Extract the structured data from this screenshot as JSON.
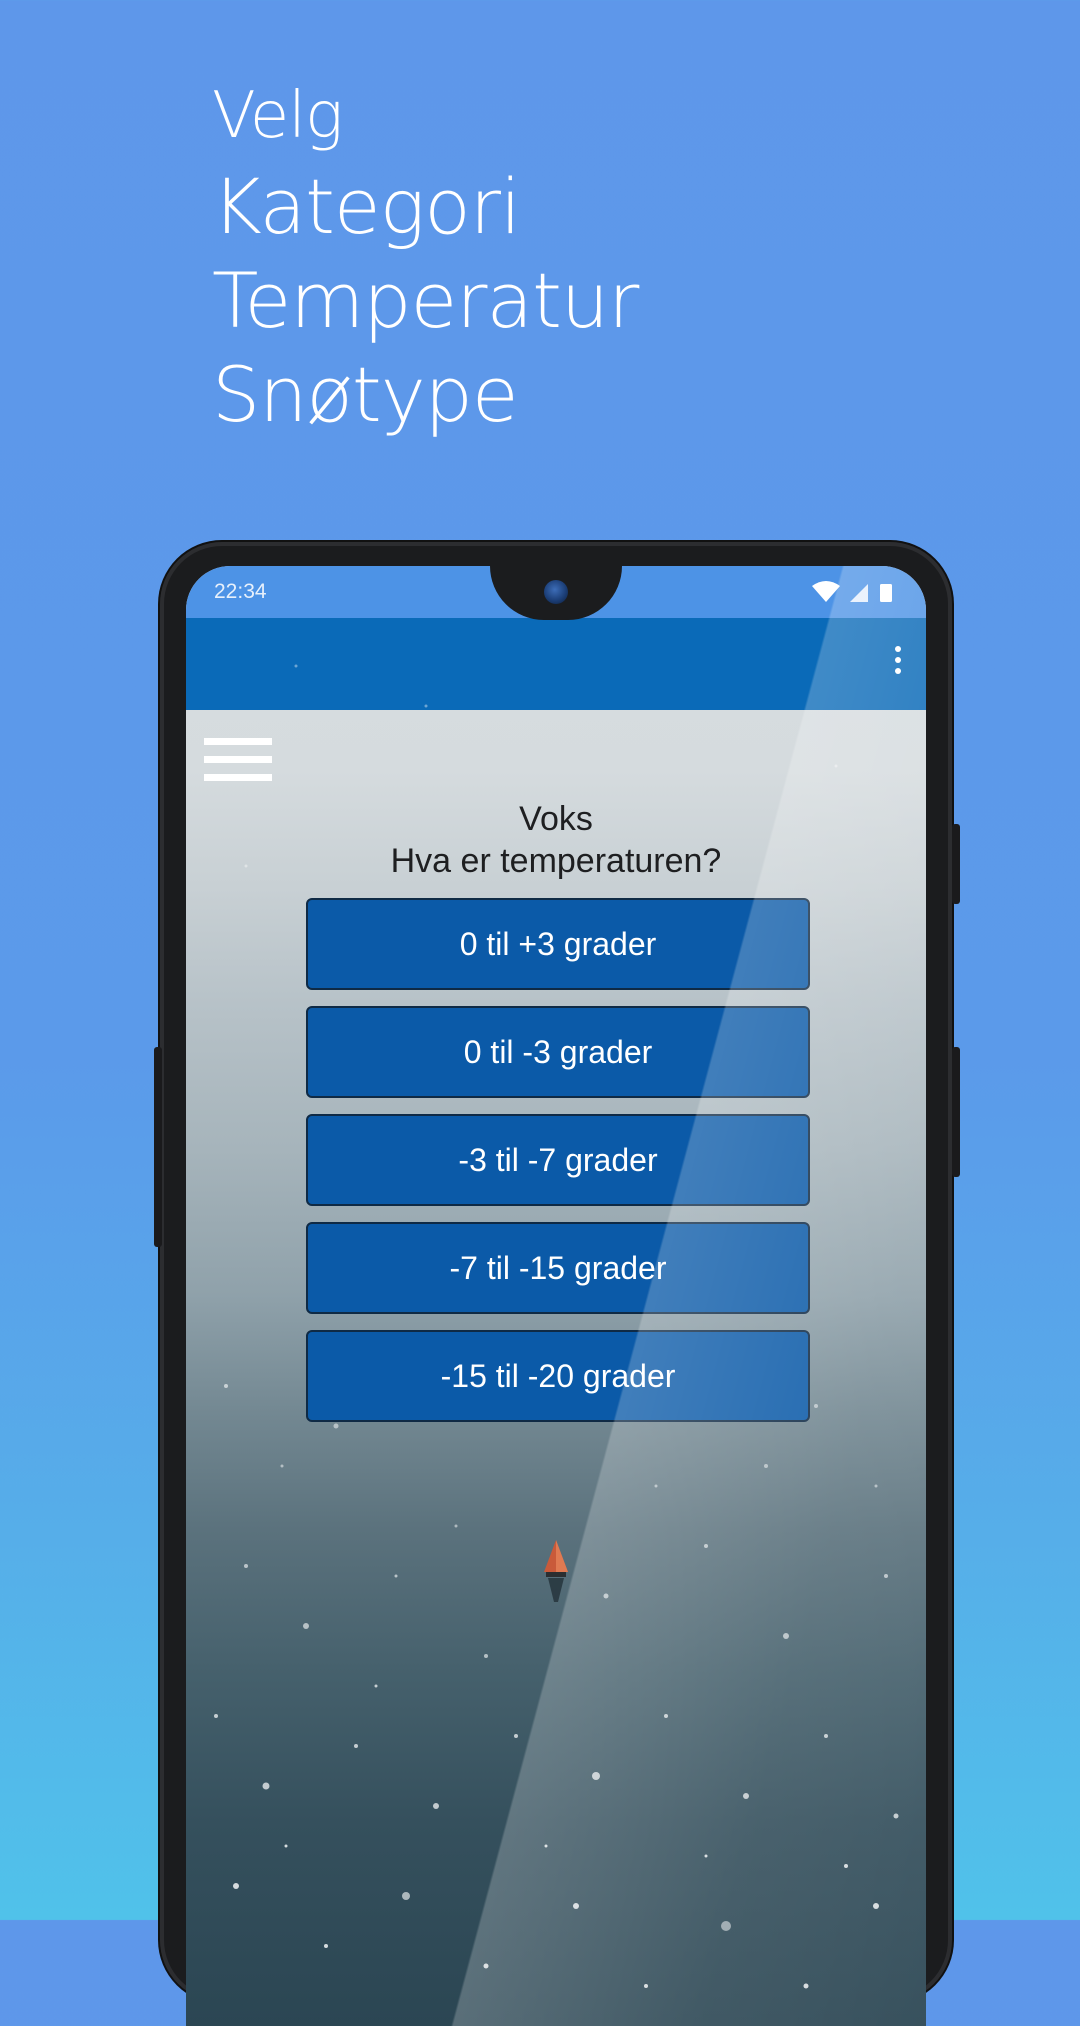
{
  "headline": {
    "line1": "Velg",
    "line2": "Kategori",
    "line3": "Temperatur",
    "line4": "Snøtype"
  },
  "status_bar": {
    "time": "22:34",
    "icons": [
      "wifi-icon",
      "signal-icon",
      "battery-icon"
    ]
  },
  "app_bar": {
    "menu_icon": "overflow-menu-icon"
  },
  "nav": {
    "icon": "hamburger-menu-icon"
  },
  "question": {
    "category": "Voks",
    "prompt": "Hva er temperaturen?"
  },
  "options": [
    {
      "label": "0 til +3 grader"
    },
    {
      "label": "0 til -3 grader"
    },
    {
      "label": "-3 til -7 grader"
    },
    {
      "label": "-7 til -15 grader"
    },
    {
      "label": "-15 til -20 grader"
    }
  ],
  "colors": {
    "background": "#5e97ea",
    "app_bar": "#0a6ab8",
    "status_bar": "#4d93e6",
    "button": "#0b5aa8"
  }
}
